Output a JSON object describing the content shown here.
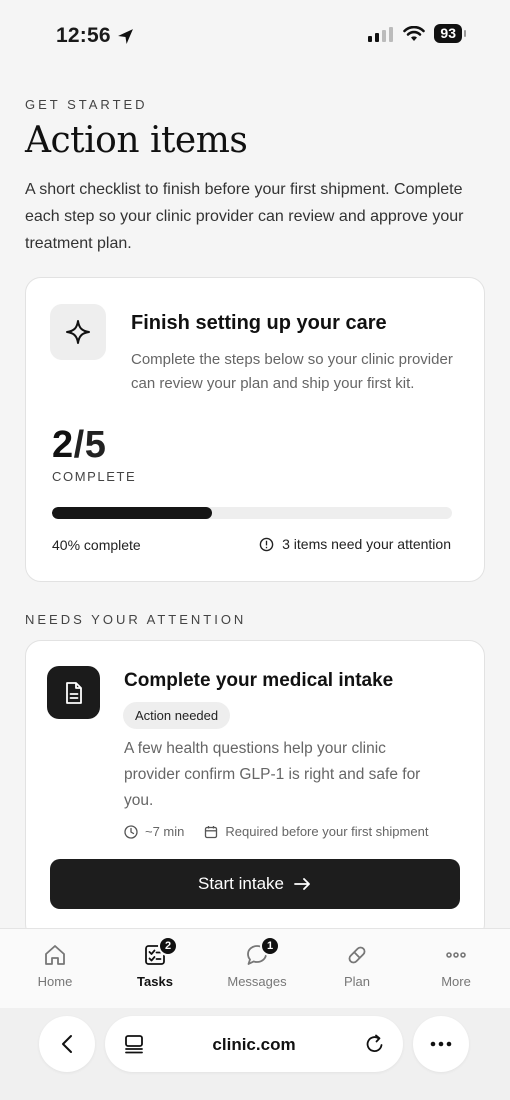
{
  "status_bar": {
    "time": "12:56",
    "battery": "93"
  },
  "header": {
    "eyebrow": "GET STARTED",
    "title": "Action items",
    "description": "A short checklist to finish before your first shipment. Complete each step so your clinic provider can review and approve your treatment plan."
  },
  "summary_card": {
    "icon": "sparkle-icon",
    "title": "Finish setting up your care",
    "description": "Complete the steps below so your clinic provider can review your plan and ship your first kit.",
    "completed": "2",
    "separator": "/",
    "total": "5",
    "complete_label": "COMPLETE",
    "progress_fraction": 0.4,
    "progress_text": "40% complete",
    "attention_text": "3 items need your attention"
  },
  "attention_section": {
    "label": "NEEDS YOUR ATTENTION"
  },
  "task_card": {
    "icon": "document-icon",
    "title": "Complete your medical intake",
    "badge": "Action needed",
    "description": "A few health questions help your clinic provider confirm GLP-1 is right and safe for you.",
    "duration": "~7 min",
    "requirement": "Required before your first shipment",
    "button_label": "Start intake"
  },
  "tab_bar": {
    "tabs": [
      {
        "label": "Home",
        "icon": "home-icon",
        "badge": ""
      },
      {
        "label": "Tasks",
        "icon": "tasks-icon",
        "badge": "2"
      },
      {
        "label": "Messages",
        "icon": "messages-icon",
        "badge": "1"
      },
      {
        "label": "Plan",
        "icon": "pill-icon",
        "badge": ""
      },
      {
        "label": "More",
        "icon": "more-icon",
        "badge": ""
      }
    ]
  },
  "browser": {
    "url": "clinic.com"
  }
}
